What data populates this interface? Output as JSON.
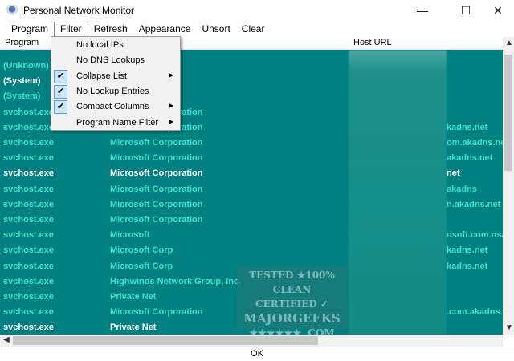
{
  "window": {
    "title": "Personal Network Monitor",
    "minimize": "—",
    "maximize": "☐",
    "close": "✕"
  },
  "menubar": [
    "Program",
    "Filter",
    "Refresh",
    "Appearance",
    "Unsort",
    "Clear"
  ],
  "columns": {
    "program": "Program",
    "host": "Host URL"
  },
  "filter_menu": [
    {
      "label": "No local IPs",
      "checked": false,
      "submenu": false
    },
    {
      "label": "No DNS Lookups",
      "checked": false,
      "submenu": false
    },
    {
      "label": "Collapse List",
      "checked": true,
      "submenu": true
    },
    {
      "label": "No Lookup Entries",
      "checked": true,
      "submenu": false
    },
    {
      "label": "Compact Columns",
      "checked": true,
      "submenu": true
    },
    {
      "label": "Program Name Filter",
      "checked": false,
      "submenu": true
    }
  ],
  "rows": [
    {
      "program": "(Unknown)",
      "company": "",
      "host": "",
      "white": false
    },
    {
      "program": "(System)",
      "company": "",
      "host": "",
      "white": true
    },
    {
      "program": "(System)",
      "company": "",
      "host": "",
      "white": false
    },
    {
      "program": "svchost.exe",
      "company": "Microsoft Corporation",
      "host": "",
      "white": false
    },
    {
      "program": "svchost.exe",
      "company": "Microsoft Corporation",
      "host": "kadns.net",
      "white": false
    },
    {
      "program": "svchost.exe",
      "company": "Microsoft Corporation",
      "host": "om.akadns.net",
      "white": false
    },
    {
      "program": "svchost.exe",
      "company": "Microsoft Corporation",
      "host": "akadns.net",
      "white": false
    },
    {
      "program": "svchost.exe",
      "company": "Microsoft Corporation",
      "host": "net",
      "white": true
    },
    {
      "program": "svchost.exe",
      "company": "Microsoft Corporation",
      "host": "akadns",
      "white": false
    },
    {
      "program": "svchost.exe",
      "company": "Microsoft Corporation",
      "host": "n.akadns.net",
      "white": false
    },
    {
      "program": "svchost.exe",
      "company": "Microsoft Corporation",
      "host": "",
      "white": false
    },
    {
      "program": "svchost.exe",
      "company": "Microsoft",
      "host": "osoft.com.nsa",
      "white": false
    },
    {
      "program": "svchost.exe",
      "company": "Microsoft Corp",
      "host": "kadns.net",
      "white": false
    },
    {
      "program": "svchost.exe",
      "company": "Microsoft Corp",
      "host": "kadns.net",
      "white": false
    },
    {
      "program": "svchost.exe",
      "company": "Highwinds Network Group, Inc.",
      "host": "",
      "white": false
    },
    {
      "program": "svchost.exe",
      "company": "Private Net",
      "host": "",
      "white": false
    },
    {
      "program": "svchost.exe",
      "company": "Microsoft Corporation",
      "host": ".com.akadns.n",
      "white": false
    },
    {
      "program": "svchost.exe",
      "company": "Private Net",
      "host": "",
      "white": true
    }
  ],
  "watermark": {
    "line1": "TESTED ★100% CLEAN",
    "line2": "CERTIFIED ✓",
    "line3": "MAJORGEEKS",
    "line4": "★★★★★★ .COM"
  },
  "ok_button": "OK"
}
